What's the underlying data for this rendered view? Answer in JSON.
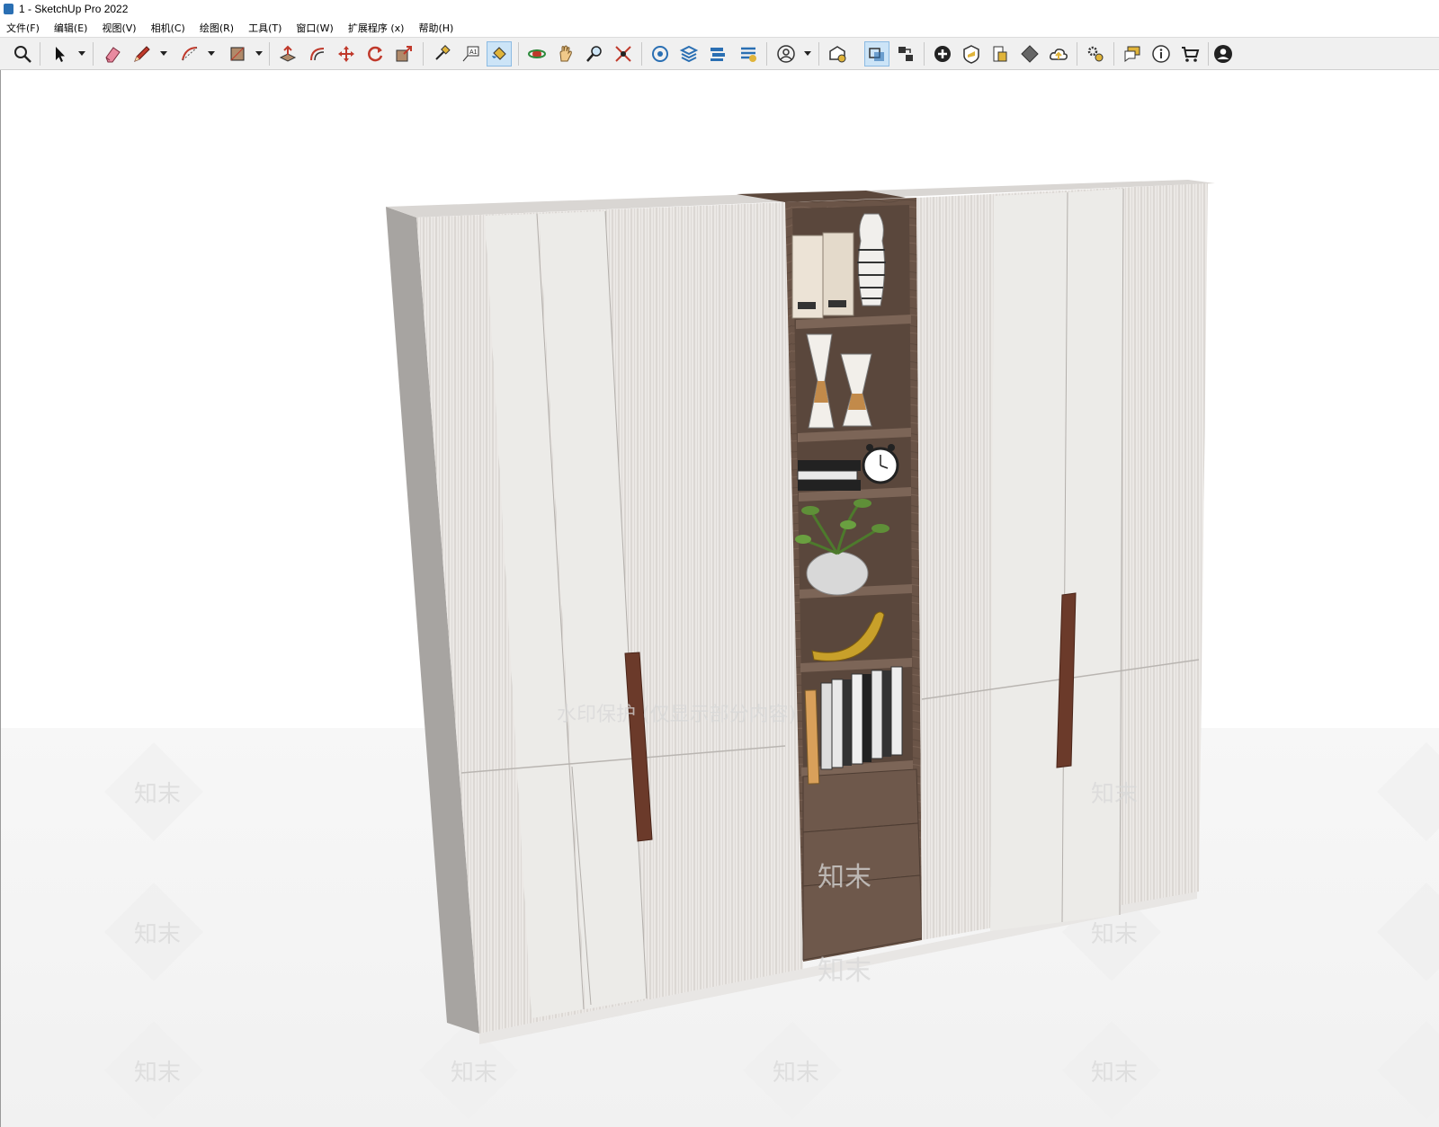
{
  "window": {
    "title": "1 - SketchUp Pro 2022"
  },
  "menu": [
    {
      "label": "文件(F)"
    },
    {
      "label": "编辑(E)"
    },
    {
      "label": "视图(V)"
    },
    {
      "label": "相机(C)"
    },
    {
      "label": "绘图(R)"
    },
    {
      "label": "工具(T)"
    },
    {
      "label": "窗口(W)"
    },
    {
      "label": "扩展程序 (x)"
    },
    {
      "label": "帮助(H)"
    }
  ],
  "toolbar": {
    "tools": [
      {
        "name": "zoom-icon"
      },
      {
        "name": "select-icon"
      },
      {
        "name": "eraser-icon"
      },
      {
        "name": "pencil-line-icon"
      },
      {
        "name": "arc-icon"
      },
      {
        "name": "rectangle-icon"
      },
      {
        "name": "push-pull-icon"
      },
      {
        "name": "offset-icon"
      },
      {
        "name": "move-icon"
      },
      {
        "name": "rotate-icon"
      },
      {
        "name": "scale-icon"
      },
      {
        "name": "tape-measure-icon"
      },
      {
        "name": "text-label-icon"
      },
      {
        "name": "paint-bucket-icon"
      },
      {
        "name": "orbit-icon"
      },
      {
        "name": "pan-icon"
      },
      {
        "name": "zoom-tool-icon"
      },
      {
        "name": "zoom-extents-icon"
      },
      {
        "name": "model-info-icon"
      },
      {
        "name": "layers-icon"
      },
      {
        "name": "components-icon"
      },
      {
        "name": "styles-icon"
      },
      {
        "name": "user-icon"
      },
      {
        "name": "warehouse-icon"
      },
      {
        "name": "sync-icon"
      },
      {
        "name": "scenes-icon"
      },
      {
        "name": "add-circle-icon"
      },
      {
        "name": "shield-icon"
      },
      {
        "name": "report-icon"
      },
      {
        "name": "checker-icon"
      },
      {
        "name": "cloud-upload-icon"
      },
      {
        "name": "settings-icon"
      },
      {
        "name": "chat-icon"
      },
      {
        "name": "info-icon"
      },
      {
        "name": "cart-icon"
      },
      {
        "name": "account-icon"
      }
    ]
  },
  "viewport": {
    "watermark_banner": "水印保护 (仅显示部分内容)",
    "watermark_tile": "知末"
  },
  "colors": {
    "door_white": "#ece9e6",
    "walnut": "#6a5447",
    "handle": "#6b3a2a",
    "active_tool": "#cce4f7"
  }
}
